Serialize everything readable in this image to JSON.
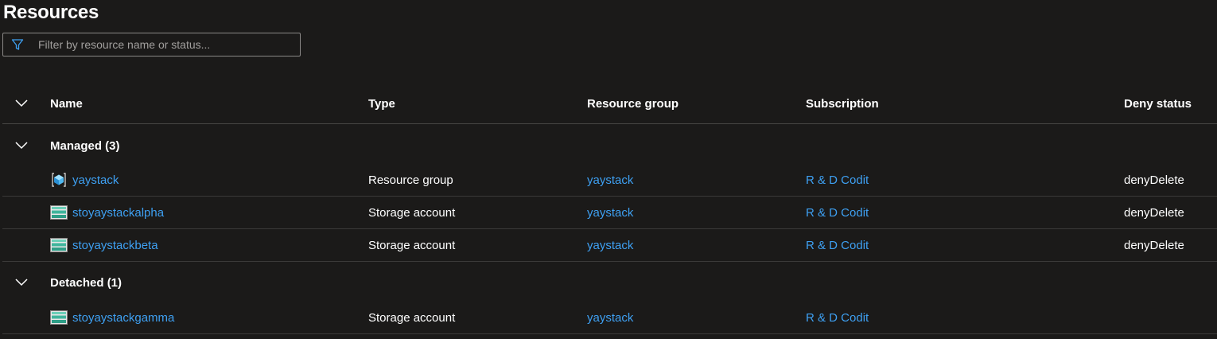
{
  "page": {
    "title": "Resources"
  },
  "filter": {
    "placeholder": "Filter by resource name or status..."
  },
  "columns": {
    "name": "Name",
    "type": "Type",
    "resource_group": "Resource group",
    "subscription": "Subscription",
    "deny_status": "Deny status"
  },
  "groups": [
    {
      "label": "Managed (3)",
      "rows": [
        {
          "icon": "resource-group-icon",
          "name": "yaystack",
          "type": "Resource group",
          "resource_group": "yaystack",
          "subscription": "R & D Codit",
          "deny_status": "denyDelete"
        },
        {
          "icon": "storage-account-icon",
          "name": "stoyaystackalpha",
          "type": "Storage account",
          "resource_group": "yaystack",
          "subscription": "R & D Codit",
          "deny_status": "denyDelete"
        },
        {
          "icon": "storage-account-icon",
          "name": "stoyaystackbeta",
          "type": "Storage account",
          "resource_group": "yaystack",
          "subscription": "R & D Codit",
          "deny_status": "denyDelete"
        }
      ]
    },
    {
      "label": "Detached (1)",
      "rows": [
        {
          "icon": "storage-account-icon",
          "name": "stoyaystackgamma",
          "type": "Storage account",
          "resource_group": "yaystack",
          "subscription": "R & D Codit",
          "deny_status": ""
        }
      ]
    }
  ],
  "colors": {
    "background": "#1b1a19",
    "link": "#3ea0f2",
    "filter_icon": "#3ea0f2"
  }
}
